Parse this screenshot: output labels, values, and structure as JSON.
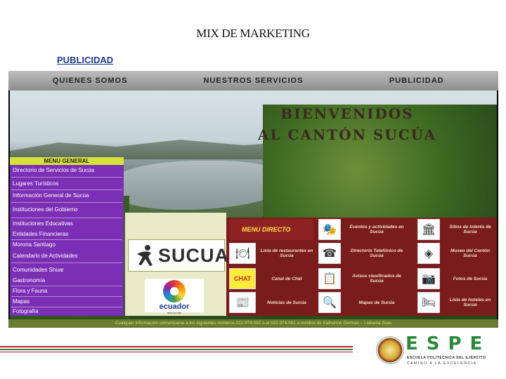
{
  "slide": {
    "title": "MIX DE MARKETING",
    "subtitle": "PUBLICIDAD"
  },
  "website": {
    "nav": [
      "QUIENES SOMOS",
      "NUESTROS SERVICIOS",
      "PUBLICIDAD"
    ],
    "welcome_line1": "BIENVENIDOS",
    "welcome_line2": "AL CANTÓN SUCÚA",
    "menu_general": {
      "heading": "MENU GENERAL",
      "items": [
        "Directorio de Servicios de Sucúa",
        "Lugares Turísticos",
        "Información General de Sucúa",
        "Instituciones del Gobierno",
        "Instituciones Educativas",
        "Entidades Financieras",
        "Morona Santiago",
        "Calendario de Actividades",
        "Comunidades Shuar",
        "Gastronomía",
        "Flora y Fauna",
        "Mapas",
        "Fotografía"
      ]
    },
    "logos": {
      "sucua": "SUCUA",
      "ecuador": "ecuador",
      "ecuador_tagline": "ama la vida"
    },
    "menu_directo": {
      "heading": "MENU DIRECTO",
      "cells": [
        {
          "icon": "theater-masks-icon",
          "glyph": "🎭",
          "label": "Eventos y actividades en Sucúa"
        },
        {
          "icon": "museum-icon",
          "glyph": "🏛",
          "label": "Sitios de interés de Sucúa"
        },
        {
          "icon": "plate-icon",
          "glyph": "🍽",
          "label": "Lista de restaurantes en Sucúa"
        },
        {
          "icon": "telephone-icon",
          "glyph": "☎",
          "label": "Directorio Telefónico de Sucúa"
        },
        {
          "icon": "museum-emblem-icon",
          "glyph": "◈",
          "label": "Museo del Cantón Sucúa"
        },
        {
          "icon": "chat-icon",
          "glyph": "CHAT",
          "label": "Canal de Chat"
        },
        {
          "icon": "clipboard-icon",
          "glyph": "📋",
          "label": "Avisos clasificados de Sucúa"
        },
        {
          "icon": "camera-icon",
          "glyph": "📷",
          "label": "Fotos de Sucúa"
        },
        {
          "icon": "newspaper-icon",
          "glyph": "📰",
          "label": "Noticias de Sucúa"
        },
        {
          "icon": "magnifier-map-icon",
          "glyph": "🔍",
          "label": "Mapas de Sucúa"
        },
        {
          "icon": "hotel-icon",
          "glyph": "🛏",
          "label": "Lista de hoteles en Sucúa"
        }
      ]
    },
    "footer": "Cualquier información comunicarse a los siguientes números 022-974-052 o al 022-974-001 a nombre de Katherine German – Lisbania Zeas"
  },
  "brand": {
    "letters": "ESPE",
    "line1": "ESCUELA POLITÉCNICA DEL EJÉRCITO",
    "line2": "CAMINO A LA EXCELENCIA"
  },
  "colors": {
    "nav_bar": "#a4a4a4",
    "menu_general_bg": "#7a2fb5",
    "menu_general_head": "#d6e13a",
    "menu_directo_bg": "#7a1c1c",
    "menu_directo_text": "#ffe04a",
    "footer_bar": "#6a7a2e",
    "rule_red": "#c8102e",
    "rule_green": "#2a8a3a",
    "espe_green": "#2a8a3a"
  }
}
